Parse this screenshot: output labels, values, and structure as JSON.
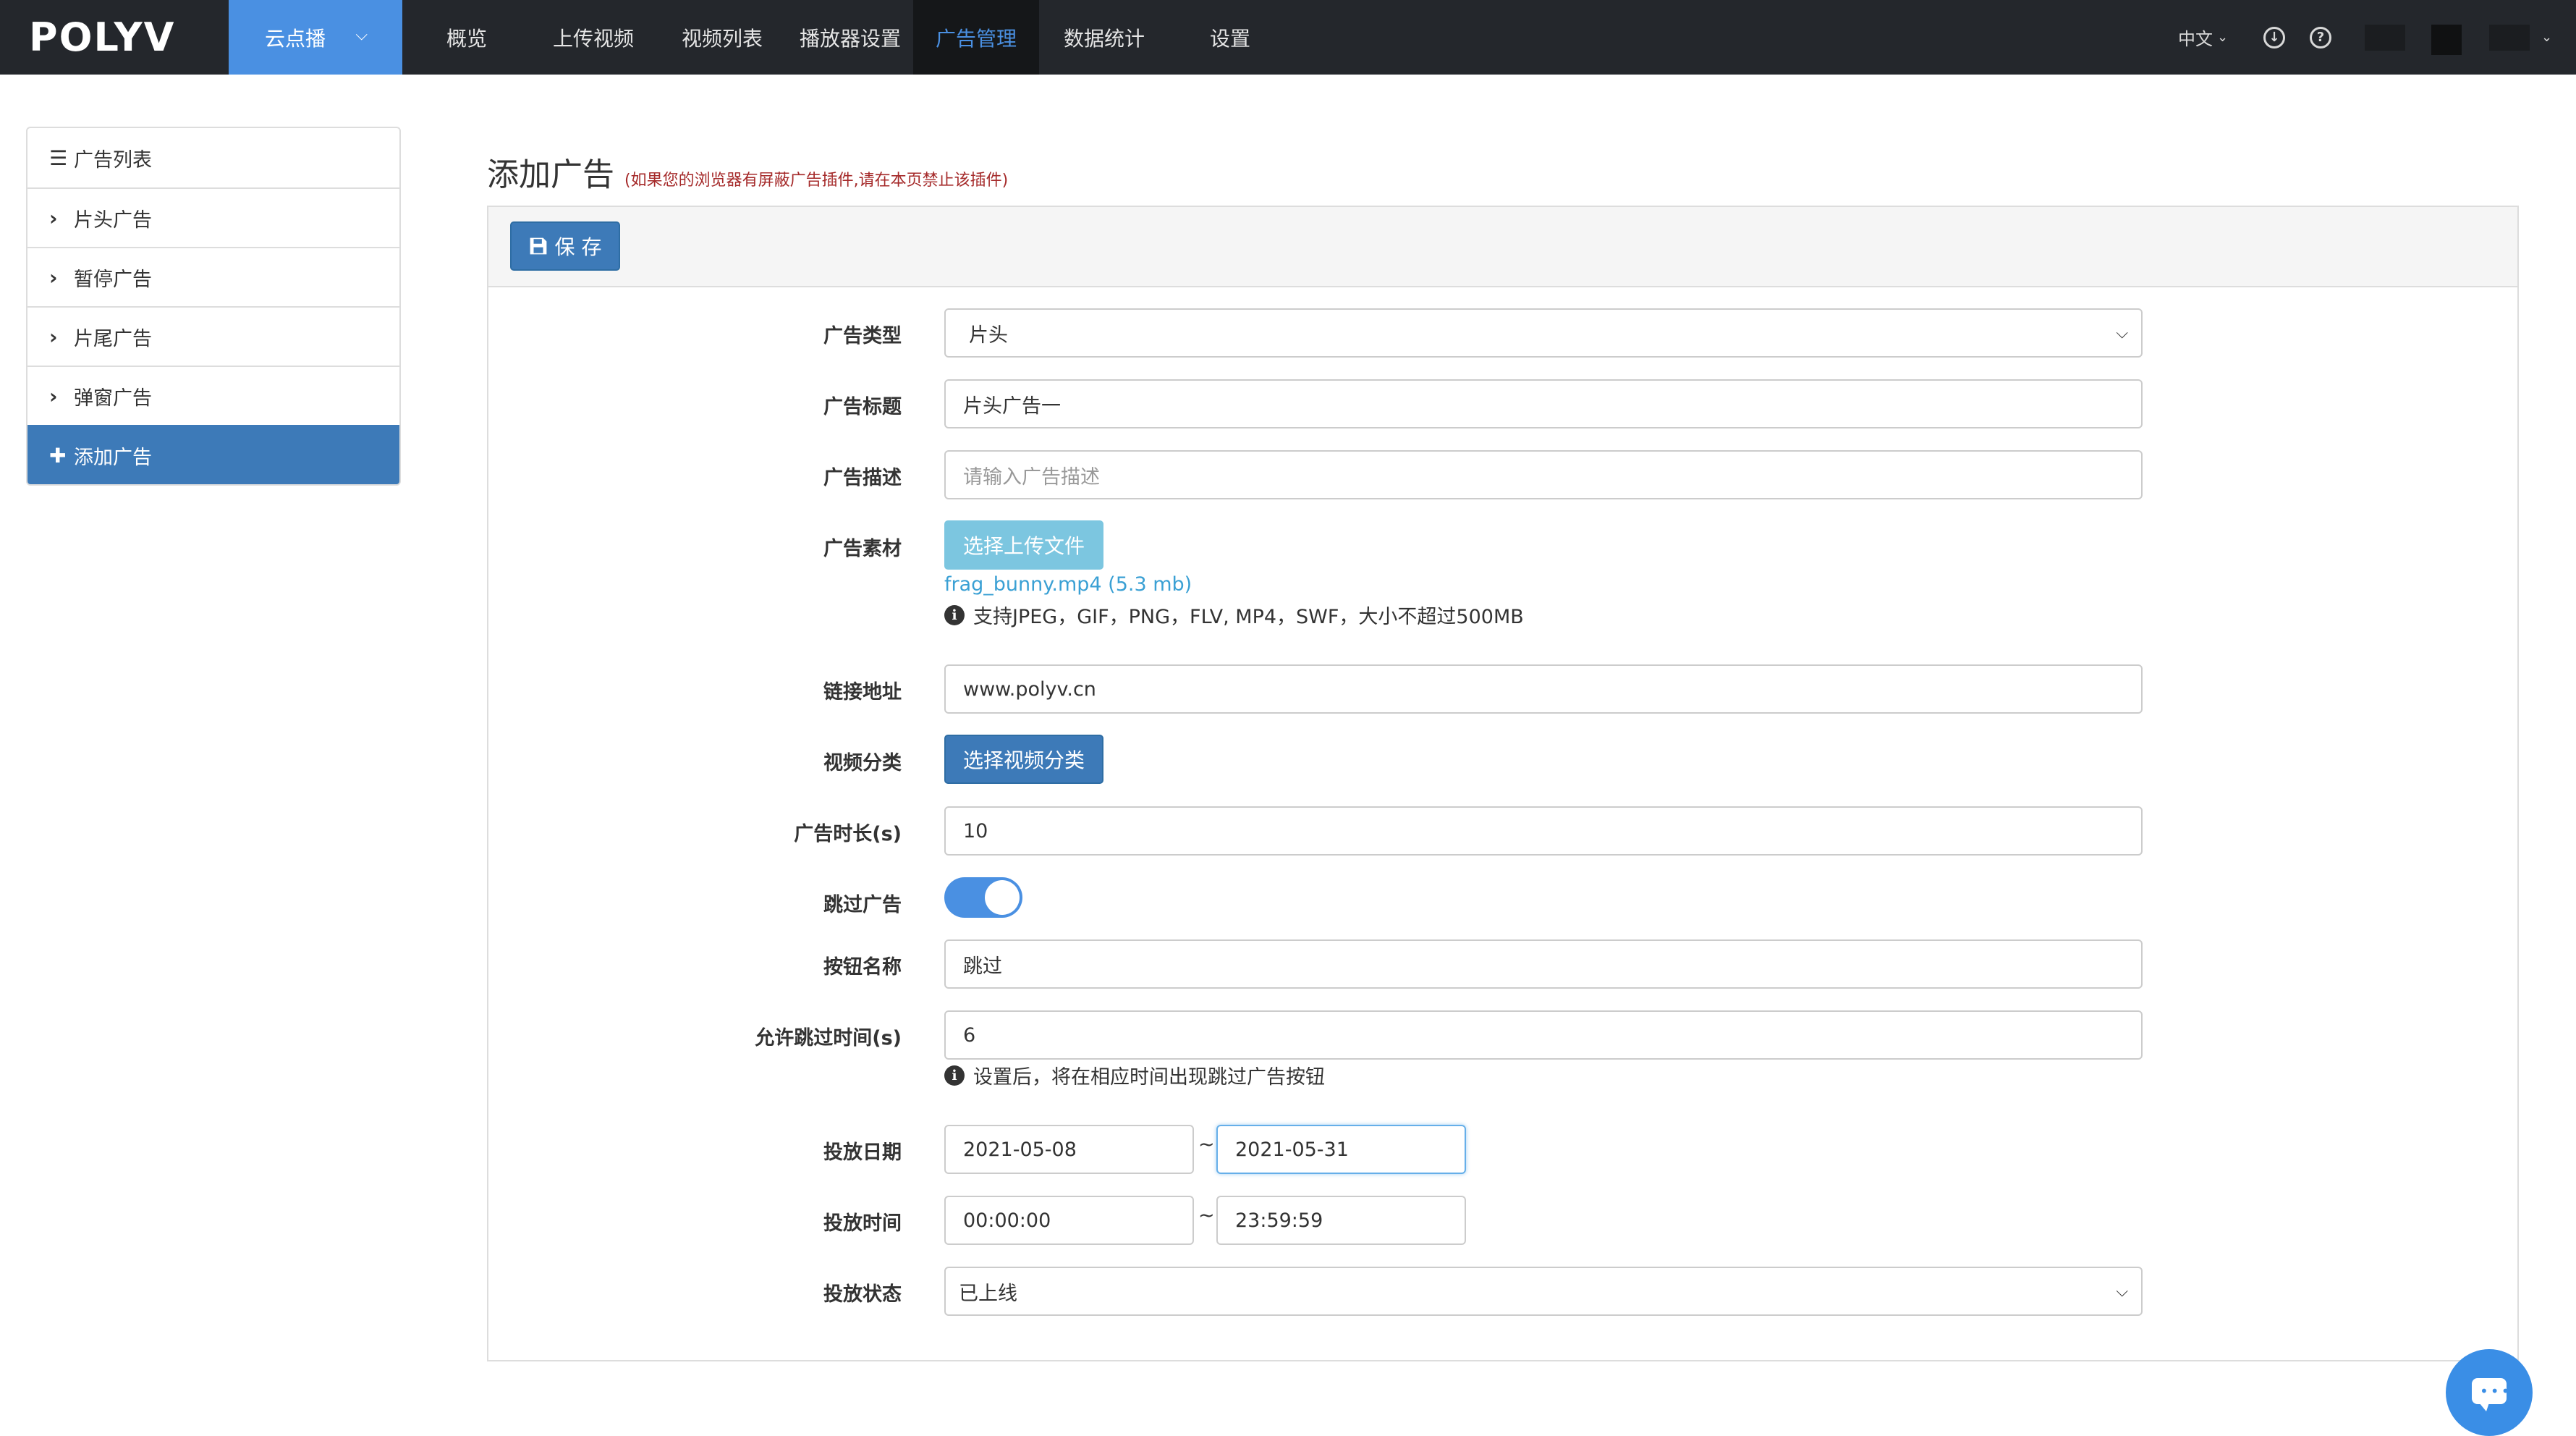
{
  "topnav": {
    "logo": "POLYV",
    "product": "云点播",
    "items": [
      "概览",
      "上传视频",
      "视频列表",
      "播放器设置",
      "广告管理",
      "数据统计",
      "设置"
    ],
    "active_item": "广告管理",
    "language": "中文"
  },
  "sidebar": {
    "items": [
      {
        "label": "广告列表",
        "icon": "list-icon"
      },
      {
        "label": "片头广告",
        "icon": "chevron-right-icon"
      },
      {
        "label": "暂停广告",
        "icon": "chevron-right-icon"
      },
      {
        "label": "片尾广告",
        "icon": "chevron-right-icon"
      },
      {
        "label": "弹窗广告",
        "icon": "chevron-right-icon"
      },
      {
        "label": "添加广告",
        "icon": "plus-icon"
      }
    ]
  },
  "page": {
    "title": "添加广告",
    "note": "(如果您的浏览器有屏蔽广告插件,请在本页禁止该插件)",
    "save_label": "保 存"
  },
  "form": {
    "type": {
      "label": "广告类型",
      "value": "片头"
    },
    "title": {
      "label": "广告标题",
      "value": "片头广告一"
    },
    "desc": {
      "label": "广告描述",
      "placeholder": "请输入广告描述"
    },
    "material": {
      "label": "广告素材",
      "button": "选择上传文件",
      "file": "frag_bunny.mp4 (5.3 mb)",
      "help": "支持JPEG，GIF，PNG，FLV, MP4，SWF，大小不超过500MB"
    },
    "link": {
      "label": "链接地址",
      "value": "www.polyv.cn"
    },
    "category": {
      "label": "视频分类",
      "button": "选择视频分类"
    },
    "duration": {
      "label": "广告时长(s)",
      "value": "10"
    },
    "skip": {
      "label": "跳过广告",
      "enabled": true
    },
    "button_name": {
      "label": "按钮名称",
      "value": "跳过"
    },
    "skip_time": {
      "label": "允许跳过时间(s)",
      "value": "6",
      "help": "设置后，将在相应时间出现跳过广告按钮"
    },
    "date": {
      "label": "投放日期",
      "start": "2021-05-08",
      "end": "2021-05-31",
      "sep": "~"
    },
    "time": {
      "label": "投放时间",
      "start": "00:00:00",
      "end": "23:59:59",
      "sep": "~"
    },
    "status": {
      "label": "投放状态",
      "value": "已上线"
    }
  },
  "colors": {
    "nav_bg": "#24272c",
    "accent": "#4a90e2",
    "primary_button": "#3d7ab8",
    "upload_button": "#7cc6e0",
    "note_red": "#a52a2a"
  }
}
